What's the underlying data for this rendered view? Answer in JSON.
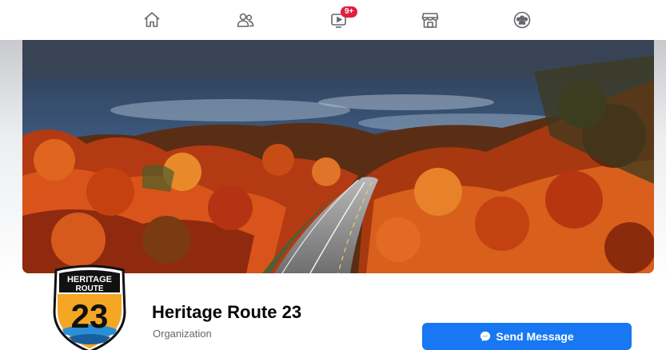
{
  "nav": {
    "items": [
      {
        "icon": "home-icon"
      },
      {
        "icon": "friends-icon"
      },
      {
        "icon": "watch-icon",
        "badge": "9+"
      },
      {
        "icon": "marketplace-icon"
      },
      {
        "icon": "groups-icon"
      }
    ]
  },
  "cover": {
    "description_icon": "cover-photo"
  },
  "logo": {
    "line1": "HERITAGE",
    "line2": "ROUTE",
    "number": "23"
  },
  "profile": {
    "name": "Heritage Route 23",
    "category": "Organization"
  },
  "actions": {
    "send_message_label": "Send Message"
  },
  "colors": {
    "accent": "#1877f2",
    "badge": "#e41e3f",
    "nav_icon": "#65676b"
  }
}
